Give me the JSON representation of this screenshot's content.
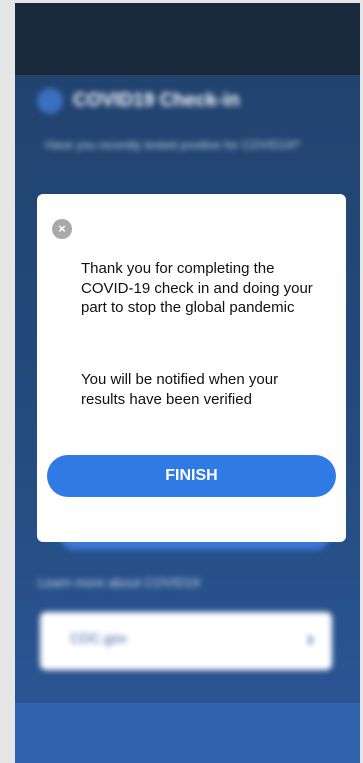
{
  "background": {
    "title": "COVID19 Check-in",
    "question": "Have you recently tested positive for COVID19?",
    "learn_more": "Learn more about COVID19",
    "link_card_label": "CDC.gov"
  },
  "modal": {
    "close_symbol": "×",
    "message_primary": "Thank you for completing the COVID-19 check in and doing your part to stop the global pandemic",
    "message_secondary": "You will be notified when your results have been verified",
    "finish_label": "FINISH"
  },
  "colors": {
    "finish_button": "#2f7ae3",
    "app_background": "#234a7c",
    "modal_background": "#ffffff"
  }
}
